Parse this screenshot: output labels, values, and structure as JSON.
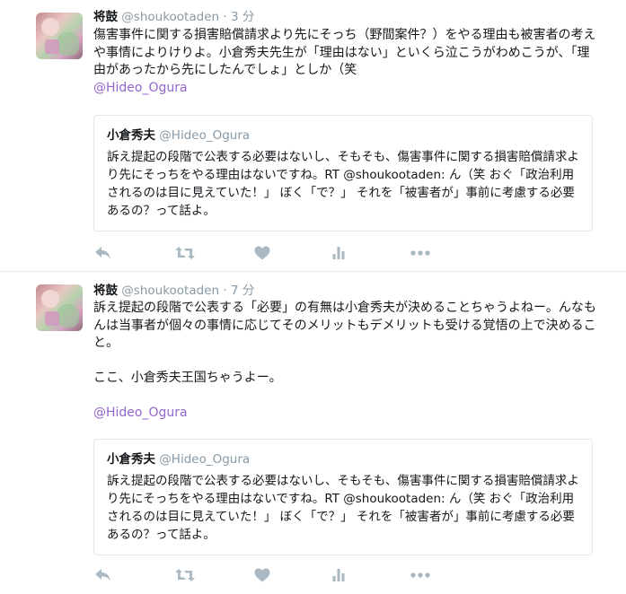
{
  "tweets": [
    {
      "author_name": "将鼓",
      "author_handle": "@shoukootaden",
      "separator": "·",
      "time": "3 分",
      "text": "傷害事件に関する損害賠償請求より先にそっち（野間案件？）をやる理由も被害者の考えや事情によりけりよ。小倉秀夫先生が「理由はない」といくら泣こうがわめこうが、「理由があったから先にしたんでしょ」としか（笑",
      "mention": "@Hideo_Ogura",
      "quote": {
        "name": "小倉秀夫",
        "handle": "@Hideo_Ogura",
        "text": "訴え提起の段階で公表する必要はないし、そもそも、傷害事件に関する損害賠償請求より先にそっちをやる理由はないですね。RT @shoukootaden: ん（笑 おぐ「政治利用されるのは目に見えていた！」 ぼく「で？」 それを「被害者が」事前に考慮する必要あるの？って話よ。"
      }
    },
    {
      "author_name": "将鼓",
      "author_handle": "@shoukootaden",
      "separator": "·",
      "time": "7 分",
      "text": "訴え提起の段階で公表する「必要」の有無は小倉秀夫が決めることちゃうよねー。んなもんは当事者が個々の事情に応じてそのメリットもデメリットも受ける覚悟の上で決めること。\n\nここ、小倉秀夫王国ちゃうよー。",
      "mention": "@Hideo_Ogura",
      "quote": {
        "name": "小倉秀夫",
        "handle": "@Hideo_Ogura",
        "text": "訴え提起の段階で公表する必要はないし、そもそも、傷害事件に関する損害賠償請求より先にそっちをやる理由はないですね。RT @shoukootaden: ん（笑 おぐ「政治利用されるのは目に見えていた！」 ぼく「で？」 それを「被害者が」事前に考慮する必要あるの？って話よ。"
      }
    }
  ],
  "actions": [
    "reply-icon",
    "retweet-icon",
    "like-icon",
    "analytics-icon",
    "more-icon"
  ],
  "colors": {
    "mention": "#9266cc",
    "meta": "#8899a6",
    "icon": "#aab8c2",
    "border": "#e1e8ed"
  }
}
